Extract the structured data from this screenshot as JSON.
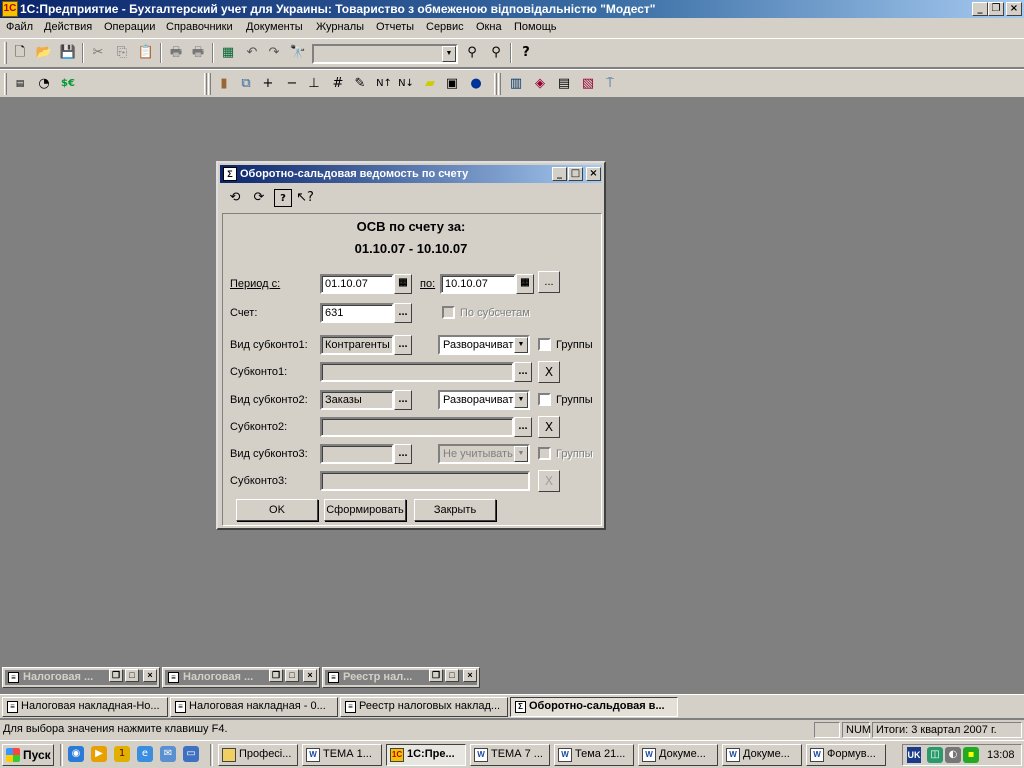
{
  "app": {
    "title": "1С:Предприятие - Бухгалтерский учет для Украины: Товариство з обмеженою відповідальністю \"Модест\"",
    "icon": "1c-icon"
  },
  "menu": [
    "Файл",
    "Действия",
    "Операции",
    "Справочники",
    "Документы",
    "Журналы",
    "Отчеты",
    "Сервис",
    "Окна",
    "Помощь"
  ],
  "dialog": {
    "title": "Оборотно-сальдовая ведомость по счету",
    "heading1": "ОСВ по счету за:",
    "heading2": "01.10.07 - 10.10.07",
    "period_from_label": "Период с:",
    "period_from": "01.10.07",
    "period_to_label": "по:",
    "period_to": "10.10.07",
    "period_more": "...",
    "account_label": "Счет:",
    "account": "631",
    "subaccounts_label": "По субсчетам",
    "kind1_label": "Вид субконто1:",
    "kind1": "Контрагенты",
    "kind1_mode": "Разворачиват",
    "groups_label": "Группы",
    "sub1_label": "Субконто1:",
    "kind2_label": "Вид субконто2:",
    "kind2": "Заказы",
    "kind2_mode": "Разворачиват",
    "sub2_label": "Субконто2:",
    "kind3_label": "Вид субконто3:",
    "kind3_mode": "Не учитывать",
    "sub3_label": "Субконто3:",
    "ok": "OK",
    "build": "Сформировать",
    "close": "Закрыть",
    "ellipsis": "...",
    "clear": "X"
  },
  "minimized": [
    {
      "title": "Налоговая ..."
    },
    {
      "title": "Налоговая ..."
    },
    {
      "title": "Реестр нал..."
    }
  ],
  "window_tabs": [
    {
      "title": "Налоговая накладная-Но..."
    },
    {
      "title": "Налоговая накладная - 0..."
    },
    {
      "title": "Реестр налоговых наклад..."
    },
    {
      "title": "Оборотно-сальдовая в..."
    }
  ],
  "status": {
    "hint": "Для выбора значения нажмите клавишу F4.",
    "num": "NUM",
    "totals": "Итоги: 3 квартал 2007 г."
  },
  "taskbar": {
    "start": "Пуск",
    "tasks": [
      {
        "title": "Професі..."
      },
      {
        "title": "ТЕМА 1..."
      },
      {
        "title": "1С:Пре..."
      },
      {
        "title": "ТЕМА 7 ..."
      },
      {
        "title": "Тема 21..."
      },
      {
        "title": "Докуме..."
      },
      {
        "title": "Докуме..."
      },
      {
        "title": "Формув..."
      }
    ],
    "lang": "UK",
    "clock": "13:08"
  },
  "colors": {
    "titlebar_start": "#0a246a",
    "titlebar_end": "#a6caf0",
    "face": "#d4d0c8",
    "desktop": "#808080"
  }
}
